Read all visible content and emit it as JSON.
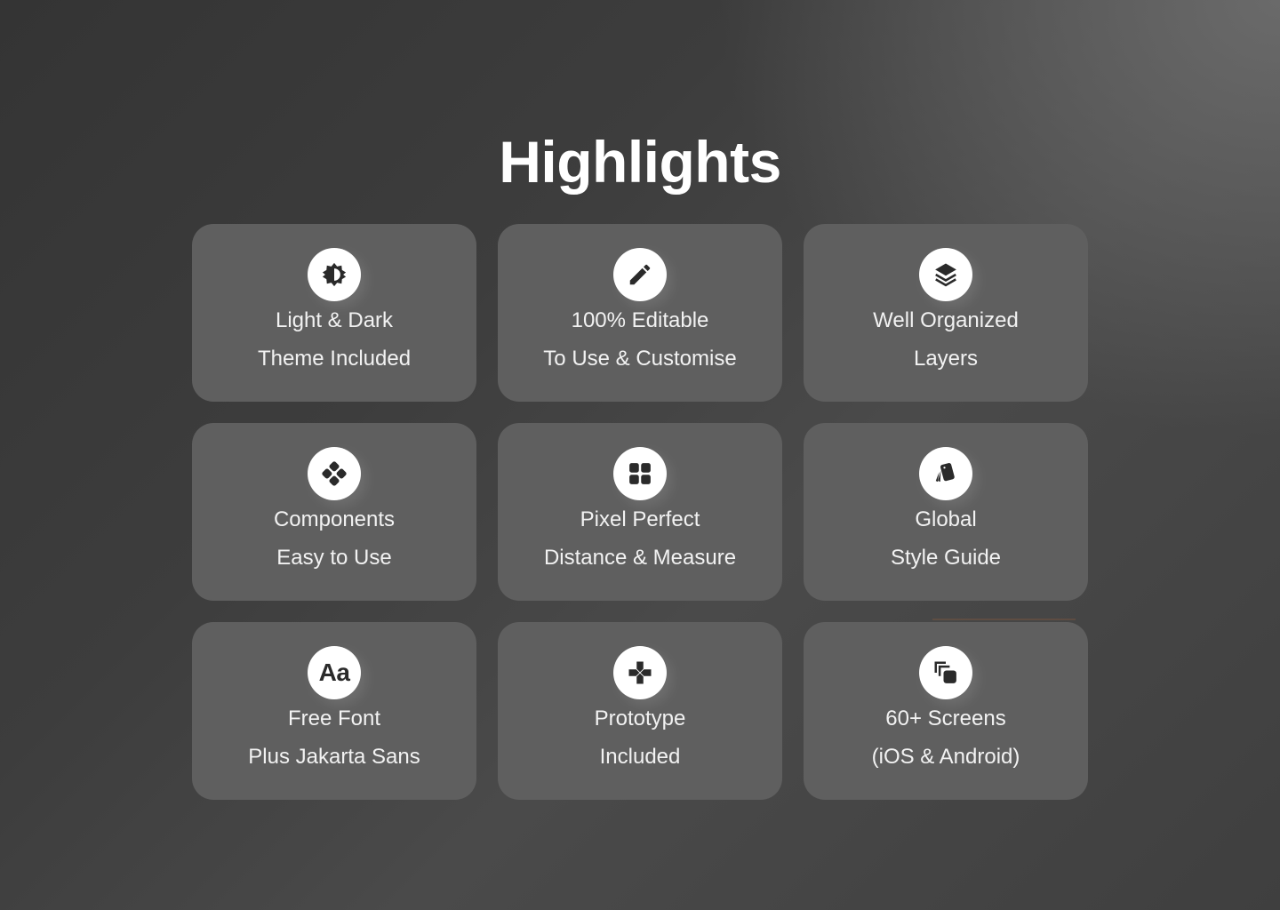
{
  "page": {
    "title": "Highlights"
  },
  "colors": {
    "card_bg": "#5f5f5f",
    "icon_bg": "#ffffff",
    "icon_fg": "#2a2a2a",
    "text": "#f2f2f2",
    "grid_purple": "#6b6a9e",
    "grid_orange": "#8a5a3c"
  },
  "cards": [
    {
      "icon": "brightness-contrast-icon",
      "line1": "Light & Dark",
      "line2": "Theme Included"
    },
    {
      "icon": "pencil-icon",
      "line1": "100% Editable",
      "line2": "To Use & Customise"
    },
    {
      "icon": "layers-icon",
      "line1": "Well Organized",
      "line2": "Layers"
    },
    {
      "icon": "components-icon",
      "line1": "Components",
      "line2": "Easy to Use"
    },
    {
      "icon": "grid-icon",
      "line1": "Pixel Perfect",
      "line2": "Distance & Measure"
    },
    {
      "icon": "swatches-icon",
      "line1": "Global",
      "line2": "Style Guide"
    },
    {
      "icon": "font-icon",
      "icon_text": "Aa",
      "line1": "Free Font",
      "line2": "Plus Jakarta Sans"
    },
    {
      "icon": "gamepad-icon",
      "line1": "Prototype",
      "line2": "Included"
    },
    {
      "icon": "copy-screens-icon",
      "line1": "60+ Screens",
      "line2": "(iOS & Android)"
    }
  ]
}
